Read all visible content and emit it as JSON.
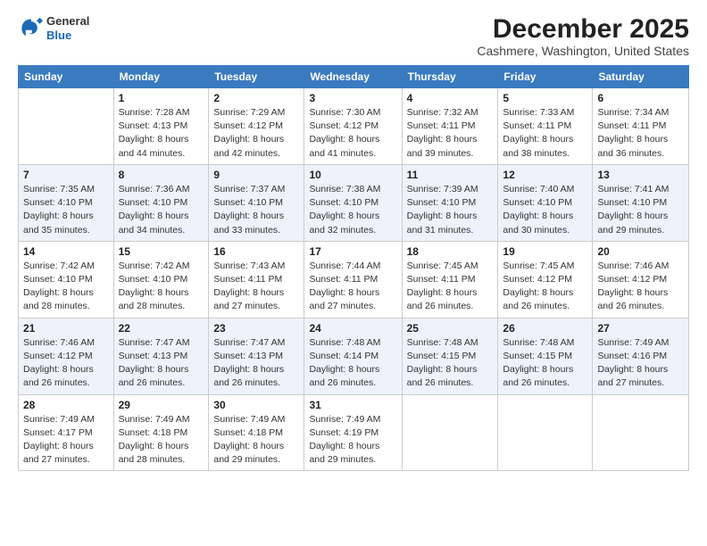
{
  "header": {
    "logo_line1": "General",
    "logo_line2": "Blue",
    "month_title": "December 2025",
    "location": "Cashmere, Washington, United States"
  },
  "days_of_week": [
    "Sunday",
    "Monday",
    "Tuesday",
    "Wednesday",
    "Thursday",
    "Friday",
    "Saturday"
  ],
  "weeks": [
    [
      {
        "day": "",
        "info": ""
      },
      {
        "day": "1",
        "info": "Sunrise: 7:28 AM\nSunset: 4:13 PM\nDaylight: 8 hours\nand 44 minutes."
      },
      {
        "day": "2",
        "info": "Sunrise: 7:29 AM\nSunset: 4:12 PM\nDaylight: 8 hours\nand 42 minutes."
      },
      {
        "day": "3",
        "info": "Sunrise: 7:30 AM\nSunset: 4:12 PM\nDaylight: 8 hours\nand 41 minutes."
      },
      {
        "day": "4",
        "info": "Sunrise: 7:32 AM\nSunset: 4:11 PM\nDaylight: 8 hours\nand 39 minutes."
      },
      {
        "day": "5",
        "info": "Sunrise: 7:33 AM\nSunset: 4:11 PM\nDaylight: 8 hours\nand 38 minutes."
      },
      {
        "day": "6",
        "info": "Sunrise: 7:34 AM\nSunset: 4:11 PM\nDaylight: 8 hours\nand 36 minutes."
      }
    ],
    [
      {
        "day": "7",
        "info": "Sunrise: 7:35 AM\nSunset: 4:10 PM\nDaylight: 8 hours\nand 35 minutes."
      },
      {
        "day": "8",
        "info": "Sunrise: 7:36 AM\nSunset: 4:10 PM\nDaylight: 8 hours\nand 34 minutes."
      },
      {
        "day": "9",
        "info": "Sunrise: 7:37 AM\nSunset: 4:10 PM\nDaylight: 8 hours\nand 33 minutes."
      },
      {
        "day": "10",
        "info": "Sunrise: 7:38 AM\nSunset: 4:10 PM\nDaylight: 8 hours\nand 32 minutes."
      },
      {
        "day": "11",
        "info": "Sunrise: 7:39 AM\nSunset: 4:10 PM\nDaylight: 8 hours\nand 31 minutes."
      },
      {
        "day": "12",
        "info": "Sunrise: 7:40 AM\nSunset: 4:10 PM\nDaylight: 8 hours\nand 30 minutes."
      },
      {
        "day": "13",
        "info": "Sunrise: 7:41 AM\nSunset: 4:10 PM\nDaylight: 8 hours\nand 29 minutes."
      }
    ],
    [
      {
        "day": "14",
        "info": "Sunrise: 7:42 AM\nSunset: 4:10 PM\nDaylight: 8 hours\nand 28 minutes."
      },
      {
        "day": "15",
        "info": "Sunrise: 7:42 AM\nSunset: 4:10 PM\nDaylight: 8 hours\nand 28 minutes."
      },
      {
        "day": "16",
        "info": "Sunrise: 7:43 AM\nSunset: 4:11 PM\nDaylight: 8 hours\nand 27 minutes."
      },
      {
        "day": "17",
        "info": "Sunrise: 7:44 AM\nSunset: 4:11 PM\nDaylight: 8 hours\nand 27 minutes."
      },
      {
        "day": "18",
        "info": "Sunrise: 7:45 AM\nSunset: 4:11 PM\nDaylight: 8 hours\nand 26 minutes."
      },
      {
        "day": "19",
        "info": "Sunrise: 7:45 AM\nSunset: 4:12 PM\nDaylight: 8 hours\nand 26 minutes."
      },
      {
        "day": "20",
        "info": "Sunrise: 7:46 AM\nSunset: 4:12 PM\nDaylight: 8 hours\nand 26 minutes."
      }
    ],
    [
      {
        "day": "21",
        "info": "Sunrise: 7:46 AM\nSunset: 4:12 PM\nDaylight: 8 hours\nand 26 minutes."
      },
      {
        "day": "22",
        "info": "Sunrise: 7:47 AM\nSunset: 4:13 PM\nDaylight: 8 hours\nand 26 minutes."
      },
      {
        "day": "23",
        "info": "Sunrise: 7:47 AM\nSunset: 4:13 PM\nDaylight: 8 hours\nand 26 minutes."
      },
      {
        "day": "24",
        "info": "Sunrise: 7:48 AM\nSunset: 4:14 PM\nDaylight: 8 hours\nand 26 minutes."
      },
      {
        "day": "25",
        "info": "Sunrise: 7:48 AM\nSunset: 4:15 PM\nDaylight: 8 hours\nand 26 minutes."
      },
      {
        "day": "26",
        "info": "Sunrise: 7:48 AM\nSunset: 4:15 PM\nDaylight: 8 hours\nand 26 minutes."
      },
      {
        "day": "27",
        "info": "Sunrise: 7:49 AM\nSunset: 4:16 PM\nDaylight: 8 hours\nand 27 minutes."
      }
    ],
    [
      {
        "day": "28",
        "info": "Sunrise: 7:49 AM\nSunset: 4:17 PM\nDaylight: 8 hours\nand 27 minutes."
      },
      {
        "day": "29",
        "info": "Sunrise: 7:49 AM\nSunset: 4:18 PM\nDaylight: 8 hours\nand 28 minutes."
      },
      {
        "day": "30",
        "info": "Sunrise: 7:49 AM\nSunset: 4:18 PM\nDaylight: 8 hours\nand 29 minutes."
      },
      {
        "day": "31",
        "info": "Sunrise: 7:49 AM\nSunset: 4:19 PM\nDaylight: 8 hours\nand 29 minutes."
      },
      {
        "day": "",
        "info": ""
      },
      {
        "day": "",
        "info": ""
      },
      {
        "day": "",
        "info": ""
      }
    ]
  ]
}
